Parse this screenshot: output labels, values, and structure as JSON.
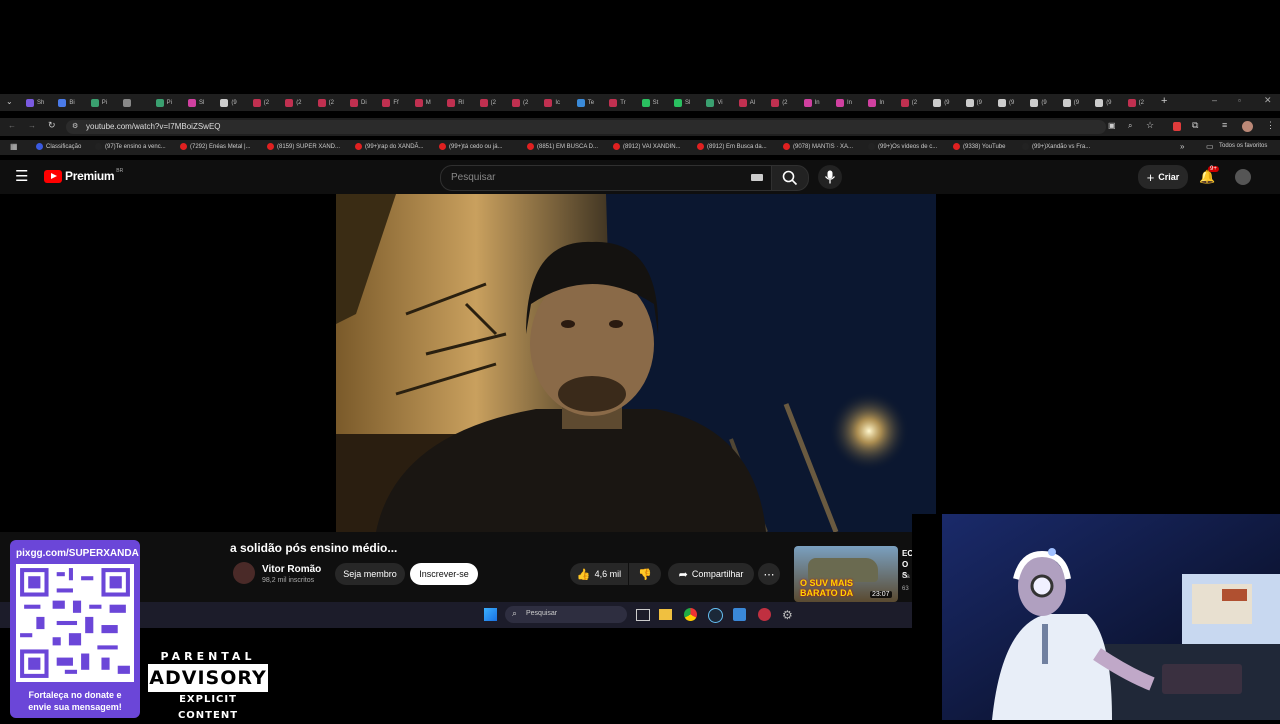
{
  "browser": {
    "tabs": [
      "Sh",
      "Bi",
      "Pi",
      "",
      "Pi",
      "Sl",
      "(9",
      "(2",
      "(2",
      "(2",
      "Di",
      "Ff",
      "M",
      "Rl",
      "(2",
      "(2",
      "Ic",
      "Te",
      "Tr",
      "St",
      "Sl",
      "Vi",
      "Al",
      "(2",
      "In",
      "In",
      "In",
      "(2",
      "(9",
      "(9",
      "(9",
      "(9",
      "(9",
      "(9",
      "(2"
    ],
    "address": "youtube.com/watch?v=I7MBoiZSwEQ",
    "bookmarks": [
      "Classificação",
      "(97)Te ensino a venc...",
      "(7292) Enéas Metal |...",
      "(8159) SUPER XAND...",
      "(99+)rap do XANDÃ...",
      "(99+)tá cedo ou já...",
      "(8851) EM BUSCA D...",
      "(8912) VAI XANDIN...",
      "(8912) Em Busca da...",
      "(9078) MANTIS · XA...",
      "(99+)Os vídeos de c...",
      "(9338) YouTube",
      "(99+)Xandão vs Fra..."
    ],
    "favorites_label": "Todos os favoritos"
  },
  "youtube": {
    "logo_text": "Premium",
    "logo_badge": "BR",
    "search_placeholder": "Pesquisar",
    "create_label": "Criar",
    "notif_badge": "9+",
    "video_title": "a solidão pós ensino médio...",
    "channel_name": "Vitor Romão",
    "subscribers": "98,2 mil inscritos",
    "join_label": "Seja membro",
    "subscribe_label": "Inscrever-se",
    "likes": "4,6 mil",
    "share_label": "Compartilhar",
    "rec_thumb_text": "O SUV MAIS BARATO DA",
    "rec_duration": "23:07",
    "rec_title": "EC O S",
    "rec_meta": "Ca",
    "rec_meta2": "63"
  },
  "taskbar": {
    "search_placeholder": "Pesquisar"
  },
  "overlay": {
    "donate_url": "pixgg.com/SUPERXANDA",
    "donate_text": "Fortaleça no donate e envie sua mensagem!",
    "advisory_top": "PARENTAL",
    "advisory_main": "ADVISORY",
    "advisory_bottom": "EXPLICIT CONTENT"
  },
  "colors": {
    "yt_red": "#ff0000",
    "bg": "#0f0f0f",
    "purple": "#6b46d8"
  }
}
